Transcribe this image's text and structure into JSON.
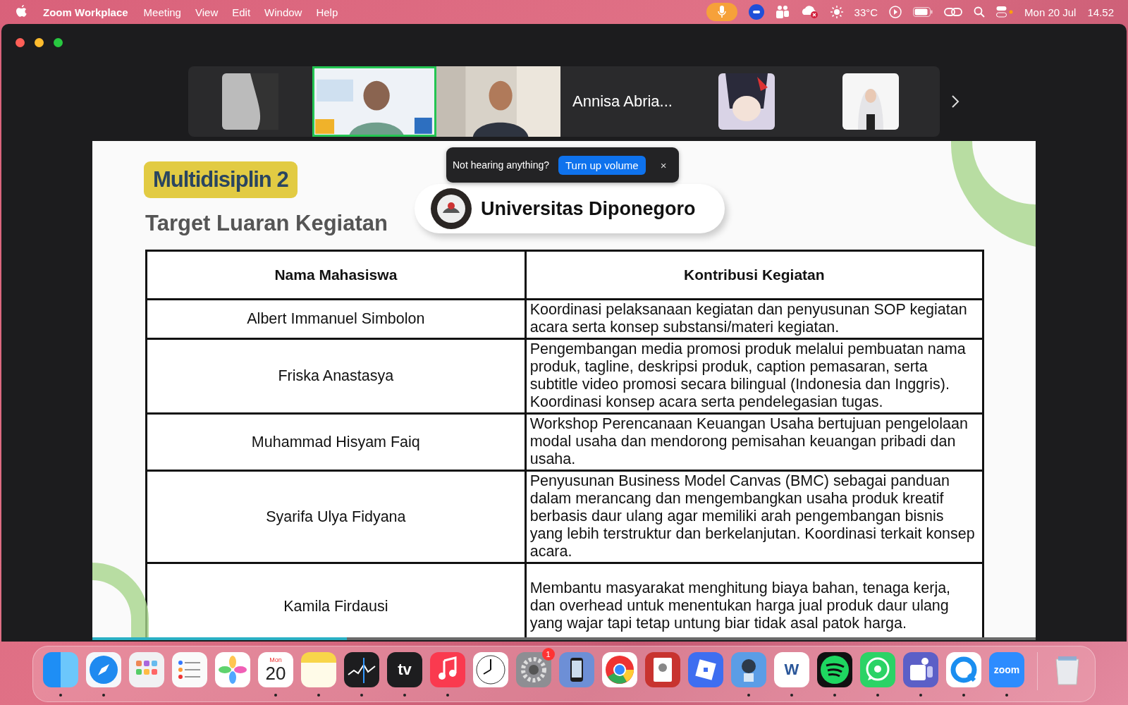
{
  "menu_bar": {
    "app": "Zoom Workplace",
    "items": [
      "Meeting",
      "View",
      "Edit",
      "Window",
      "Help"
    ],
    "weather": "33°C",
    "date": "Mon 20 Jul",
    "time": "14.52"
  },
  "thumbnails": [
    {
      "kind": "picture",
      "selected": false
    },
    {
      "kind": "picture",
      "selected": true
    },
    {
      "kind": "picture",
      "selected": false
    },
    {
      "kind": "name",
      "name": "Annisa Abria...",
      "selected": false
    },
    {
      "kind": "picture",
      "selected": false
    },
    {
      "kind": "picture",
      "selected": false
    }
  ],
  "toast": {
    "text": "Not hearing anything?",
    "button": "Turn up volume",
    "close": "×"
  },
  "slide": {
    "badge": "Multidisiplin 2",
    "university": "Universitas Diponegoro",
    "title": "Target Luaran Kegiatan",
    "table": {
      "columns": [
        "Nama Mahasiswa",
        "Kontribusi Kegiatan"
      ],
      "rows": [
        [
          "Albert Immanuel Simbolon",
          "Koordinasi pelaksanaan kegiatan dan penyusunan SOP kegiatan acara serta konsep substansi/materi kegiatan."
        ],
        [
          "Friska Anastasya",
          "Pengembangan media promosi produk melalui pembuatan nama produk, tagline, deskripsi produk, caption pemasaran, serta subtitle video promosi secara bilingual (Indonesia dan Inggris). Koordinasi konsep acara serta pendelegasian tugas."
        ],
        [
          "Muhammad Hisyam Faiq",
          "Workshop Perencanaan Keuangan Usaha bertujuan pengelolaan modal usaha dan mendorong pemisahan keuangan pribadi dan usaha."
        ],
        [
          "Syarifa Ulya Fidyana",
          "Penyusunan Business Model Canvas (BMC) sebagai panduan dalam merancang dan mengembangkan usaha produk kreatif berbasis daur ulang agar memiliki arah pengembangan bisnis yang lebih terstruktur dan berkelanjutan. Koordinasi terkait konsep acara."
        ],
        [
          "Kamila Firdausi",
          "Membantu masyarakat menghitung biaya bahan, tenaga kerja, dan overhead untuk menentukan harga jual produk daur ulang yang wajar tapi tetap untung biar tidak asal patok harga."
        ]
      ]
    },
    "progress": {
      "level": 0.27
    }
  },
  "dock": [
    {
      "kind": "finder",
      "running": true
    },
    {
      "kind": "safari",
      "running": true
    },
    {
      "kind": "launchpad",
      "running": false
    },
    {
      "kind": "reminders",
      "running": false
    },
    {
      "kind": "photos",
      "running": false
    },
    {
      "kind": "calendar",
      "month": "Mon",
      "day": "20",
      "running": true
    },
    {
      "kind": "notes",
      "running": true
    },
    {
      "kind": "stocks",
      "running": true
    },
    {
      "kind": "tv",
      "label": "tv",
      "running": true
    },
    {
      "kind": "music",
      "running": true
    },
    {
      "kind": "clock",
      "running": false
    },
    {
      "kind": "settings",
      "badge": "1",
      "running": false
    },
    {
      "kind": "simulator",
      "running": false
    },
    {
      "kind": "chrome",
      "running": false
    },
    {
      "kind": "photobooth",
      "running": false
    },
    {
      "kind": "roblox",
      "running": false
    },
    {
      "kind": "preview",
      "running": true
    },
    {
      "kind": "word",
      "label": "W",
      "running": true
    },
    {
      "kind": "spotify",
      "running": true
    },
    {
      "kind": "whatsapp",
      "running": true
    },
    {
      "kind": "teams",
      "running": true
    },
    {
      "kind": "quicktime",
      "running": true
    },
    {
      "kind": "zoom",
      "label": "zoom",
      "running": true
    },
    {
      "kind": "trash",
      "running": false
    }
  ]
}
